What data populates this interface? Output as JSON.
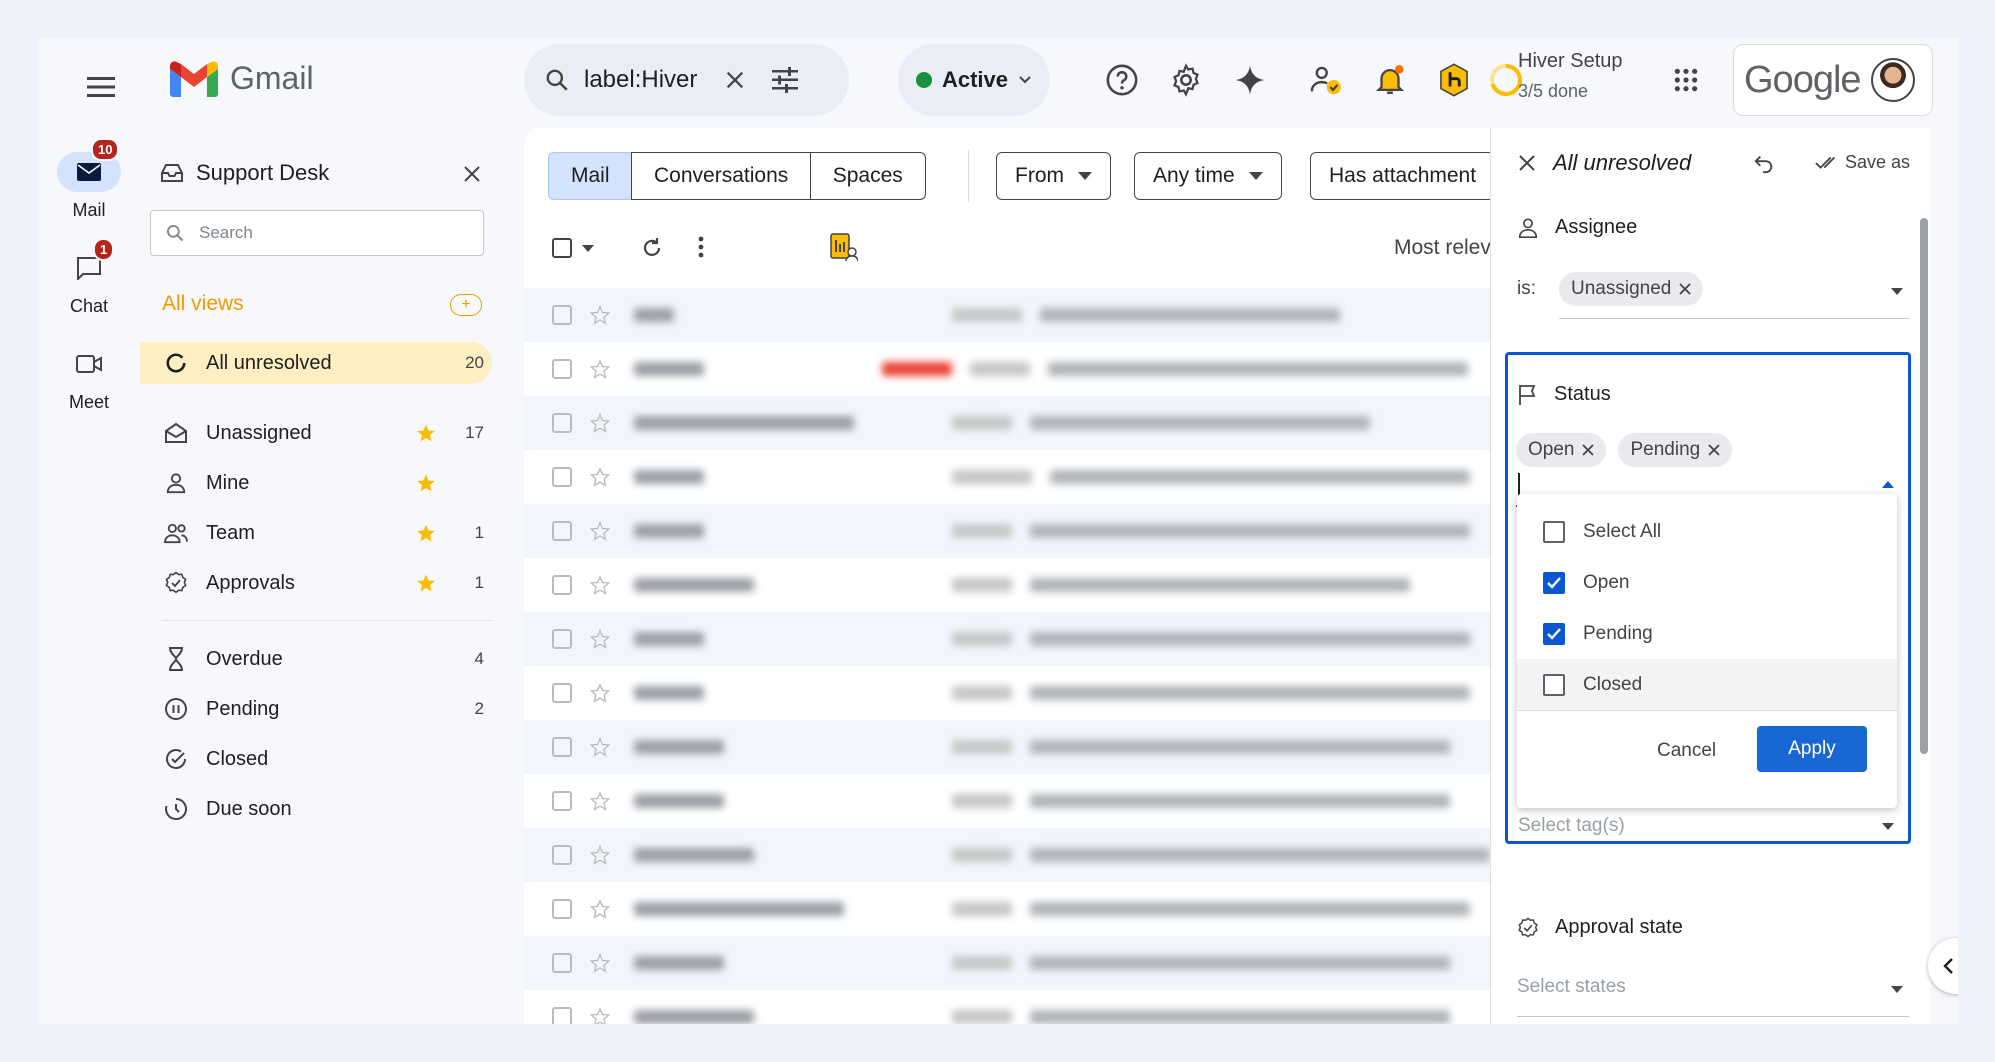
{
  "topbar": {
    "app_name": "Gmail",
    "search_value": "label:Hiver",
    "status_label": "Active",
    "setup_title": "Hiver Setup",
    "setup_progress": "3/5 done",
    "account_brand": "Google"
  },
  "rail": {
    "mail_label": "Mail",
    "mail_badge": "10",
    "chat_label": "Chat",
    "chat_badge": "1",
    "meet_label": "Meet"
  },
  "hiver_panel": {
    "title": "Support Desk",
    "search_placeholder": "Search",
    "all_views_label": "All views",
    "add_label": "+",
    "selected_view": {
      "label": "All unresolved",
      "count": "20"
    },
    "starred_views": [
      {
        "label": "Unassigned",
        "count": "17",
        "icon": "inbox-icon"
      },
      {
        "label": "Mine",
        "count": "",
        "icon": "person-icon"
      },
      {
        "label": "Team",
        "count": "1",
        "icon": "group-icon"
      },
      {
        "label": "Approvals",
        "count": "1",
        "icon": "approval-icon"
      }
    ],
    "status_views": [
      {
        "label": "Overdue",
        "count": "4",
        "icon": "hourglass-icon"
      },
      {
        "label": "Pending",
        "count": "2",
        "icon": "pause-icon"
      },
      {
        "label": "Closed",
        "count": "",
        "icon": "check-circle-icon"
      },
      {
        "label": "Due soon",
        "count": "",
        "icon": "clock-icon"
      }
    ],
    "star_color": "#fbbc04",
    "accent_color": "#f29900"
  },
  "main": {
    "tabs": [
      "Mail",
      "Conversations",
      "Spaces"
    ],
    "filters": [
      "From",
      "Any time",
      "Has attachment"
    ],
    "sort_label": "Most relev"
  },
  "filter_panel": {
    "title": "All unresolved",
    "save_label": "Save as",
    "assignee": {
      "label": "Assignee",
      "operator": "is:",
      "chip": "Unassigned"
    },
    "status": {
      "label": "Status",
      "chips": [
        "Open",
        "Pending"
      ],
      "options": [
        {
          "label": "Select All",
          "checked": false
        },
        {
          "label": "Open",
          "checked": true
        },
        {
          "label": "Pending",
          "checked": true
        },
        {
          "label": "Closed",
          "checked": false
        }
      ],
      "cancel_label": "Cancel",
      "apply_label": "Apply"
    },
    "tags_placeholder": "Select tag(s)",
    "approval": {
      "label": "Approval state",
      "placeholder": "Select states"
    },
    "accent_color": "#0b57d0"
  }
}
